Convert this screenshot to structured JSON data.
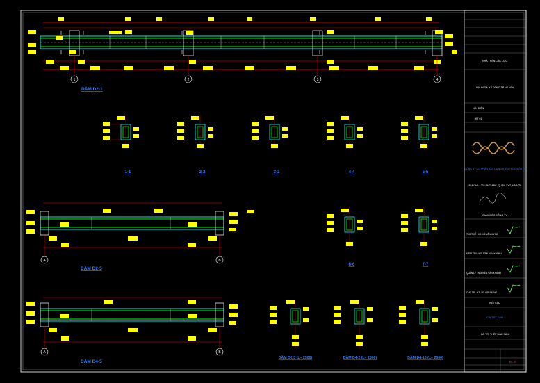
{
  "beams": {
    "beam1": {
      "title": "DẦM D2-1",
      "axes": [
        "1",
        "2",
        "3",
        "4"
      ]
    },
    "beam2": {
      "title": "DẦM D2-5",
      "axes": [
        "A",
        "B"
      ]
    },
    "beam3": {
      "title": "DẦM D4-5",
      "axes": [
        "A",
        "B"
      ]
    }
  },
  "sections": {
    "row1": [
      "1-1",
      "2-2",
      "3-3",
      "4-4",
      "5-5"
    ],
    "row2": [
      "6-6",
      "7-7"
    ]
  },
  "small_beams": [
    "DẦM D2-3 (L= 2500)",
    "DẦM D4-2 (L= 2300)",
    "DẦM D4-10 (L= 2000)"
  ],
  "title_block": {
    "project": "NHÀ TRÊN CÁC CỌC",
    "location": "ĐỊA ĐIỂM: XÃ ĐÔNG  TP HÀ NỘI",
    "stage": "LAN ĐIỆN",
    "rev": "HƯ 01",
    "company": "CÔNG TY CỔ PHẦN XÂY DỰNG KIẾN TRÚC ĐÔ THỊ",
    "address": "ĐỊA CHỈ: 1234 PHỐ ABC, QUẬN XYZ, HÀ NỘI",
    "director": "GIÁM ĐỐC CÔNG TY",
    "roles": [
      "THIẾT KẾ : KS. VŨ VĂN HƯNG",
      "KIỂM TRA : NGUYỄN VĂN KHÁNH",
      "QUẢN LÝ : NGUYỄN VĂN KHÁNH",
      "CHỦ TRÌ : KS. VŨ VĂN HƯNG"
    ],
    "sheet_name": "KẾT CẤU",
    "sheet_sub": "CHI TIẾT DẦM",
    "sheet_bottom": "BỐ TRÍ THÉP DẦM SÀN",
    "sheet_no": "KC-09"
  },
  "colors": {
    "frame": "#ffffff",
    "concrete": "#00ffff",
    "rebar": "#00ff00",
    "dimension": "#ff0000",
    "tag": "#ffff00",
    "text": "#ffffff",
    "title": "#2f7fff"
  }
}
